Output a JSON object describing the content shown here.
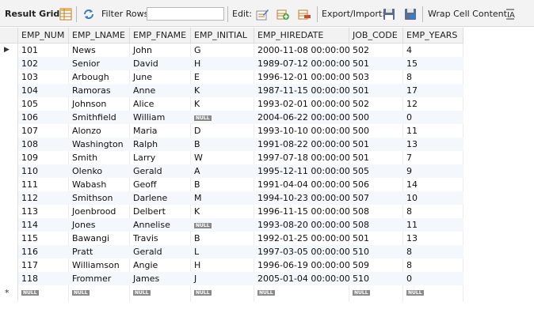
{
  "toolbar": {
    "tab": "Result Grid",
    "filter_label": "Filter Rows:",
    "filter_value": "",
    "edit_label": "Edit:",
    "export_label": "Export/Import:",
    "wrap_label": "Wrap Cell Content:"
  },
  "null_label": "NULL",
  "new_row_marker": "*",
  "current_row_marker": "▶",
  "columns": [
    "EMP_NUM",
    "EMP_LNAME",
    "EMP_FNAME",
    "EMP_INITIAL",
    "EMP_HIREDATE",
    "JOB_CODE",
    "EMP_YEARS"
  ],
  "rows": [
    {
      "num": "101",
      "lname": "News",
      "fname": "John",
      "initial": "G",
      "hiredate": "2000-11-08 00:00:00",
      "job": "502",
      "years": "4"
    },
    {
      "num": "102",
      "lname": "Senior",
      "fname": "David",
      "initial": "H",
      "hiredate": "1989-07-12 00:00:00",
      "job": "501",
      "years": "15"
    },
    {
      "num": "103",
      "lname": "Arbough",
      "fname": "June",
      "initial": "E",
      "hiredate": "1996-12-01 00:00:00",
      "job": "503",
      "years": "8"
    },
    {
      "num": "104",
      "lname": "Ramoras",
      "fname": "Anne",
      "initial": "K",
      "hiredate": "1987-11-15 00:00:00",
      "job": "501",
      "years": "17"
    },
    {
      "num": "105",
      "lname": "Johnson",
      "fname": "Alice",
      "initial": "K",
      "hiredate": "1993-02-01 00:00:00",
      "job": "502",
      "years": "12"
    },
    {
      "num": "106",
      "lname": "Smithfield",
      "fname": "William",
      "initial": null,
      "hiredate": "2004-06-22 00:00:00",
      "job": "500",
      "years": "0"
    },
    {
      "num": "107",
      "lname": "Alonzo",
      "fname": "Maria",
      "initial": "D",
      "hiredate": "1993-10-10 00:00:00",
      "job": "500",
      "years": "11"
    },
    {
      "num": "108",
      "lname": "Washington",
      "fname": "Ralph",
      "initial": "B",
      "hiredate": "1991-08-22 00:00:00",
      "job": "501",
      "years": "13"
    },
    {
      "num": "109",
      "lname": "Smith",
      "fname": "Larry",
      "initial": "W",
      "hiredate": "1997-07-18 00:00:00",
      "job": "501",
      "years": "7"
    },
    {
      "num": "110",
      "lname": "Olenko",
      "fname": "Gerald",
      "initial": "A",
      "hiredate": "1995-12-11 00:00:00",
      "job": "505",
      "years": "9"
    },
    {
      "num": "111",
      "lname": "Wabash",
      "fname": "Geoff",
      "initial": "B",
      "hiredate": "1991-04-04 00:00:00",
      "job": "506",
      "years": "14"
    },
    {
      "num": "112",
      "lname": "Smithson",
      "fname": "Darlene",
      "initial": "M",
      "hiredate": "1994-10-23 00:00:00",
      "job": "507",
      "years": "10"
    },
    {
      "num": "113",
      "lname": "Joenbrood",
      "fname": "Delbert",
      "initial": "K",
      "hiredate": "1996-11-15 00:00:00",
      "job": "508",
      "years": "8"
    },
    {
      "num": "114",
      "lname": "Jones",
      "fname": "Annelise",
      "initial": null,
      "hiredate": "1993-08-20 00:00:00",
      "job": "508",
      "years": "11"
    },
    {
      "num": "115",
      "lname": "Bawangi",
      "fname": "Travis",
      "initial": "B",
      "hiredate": "1992-01-25 00:00:00",
      "job": "501",
      "years": "13"
    },
    {
      "num": "116",
      "lname": "Pratt",
      "fname": "Gerald",
      "initial": "L",
      "hiredate": "1997-03-05 00:00:00",
      "job": "510",
      "years": "8"
    },
    {
      "num": "117",
      "lname": "Williamson",
      "fname": "Angie",
      "initial": "H",
      "hiredate": "1996-06-19 00:00:00",
      "job": "509",
      "years": "8"
    },
    {
      "num": "118",
      "lname": "Frommer",
      "fname": "James",
      "initial": "J",
      "hiredate": "2005-01-04 00:00:00",
      "job": "510",
      "years": "0"
    }
  ],
  "icons": {
    "grid": "result-grid-icon",
    "filter": "refresh-filter-icon",
    "edit": "edit-row-icon",
    "add": "add-row-icon",
    "delete": "delete-row-icon",
    "export": "export-icon",
    "import": "import-icon",
    "wrap": "wrap-cell-icon"
  }
}
